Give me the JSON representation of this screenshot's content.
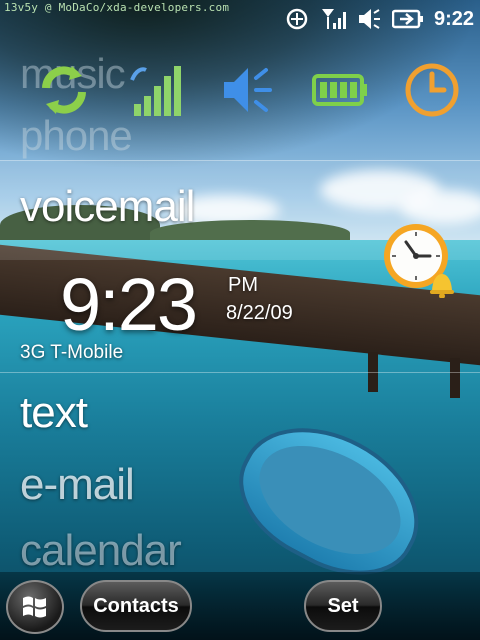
{
  "status_bar": {
    "credit": "13v5y @ MoDaCo/xda-developers.com",
    "time": "9:22",
    "icons": [
      "connectivity-icon",
      "signal-icon",
      "volume-icon",
      "battery-icon"
    ]
  },
  "top_icons": [
    "sync-icon",
    "signal-strength-icon",
    "speaker-icon",
    "battery-icon",
    "clock-icon"
  ],
  "faded_menu": {
    "music": "music",
    "phone": "phone"
  },
  "menu": {
    "voicemail": "voicemail",
    "text": "text",
    "email": "e-mail",
    "calendar": "calendar"
  },
  "clock": {
    "time": "9:23",
    "ampm": "PM",
    "date": "8/22/09",
    "carrier": "3G T-Mobile"
  },
  "softkeys": {
    "left": "Contacts",
    "right": "Set"
  },
  "colors": {
    "sync_green": "#8ccf4a",
    "signal_green": "#8fd46a",
    "speaker_blue": "#3f8fe8",
    "battery_green": "#7fd04a",
    "clock_orange": "#f0a030"
  }
}
